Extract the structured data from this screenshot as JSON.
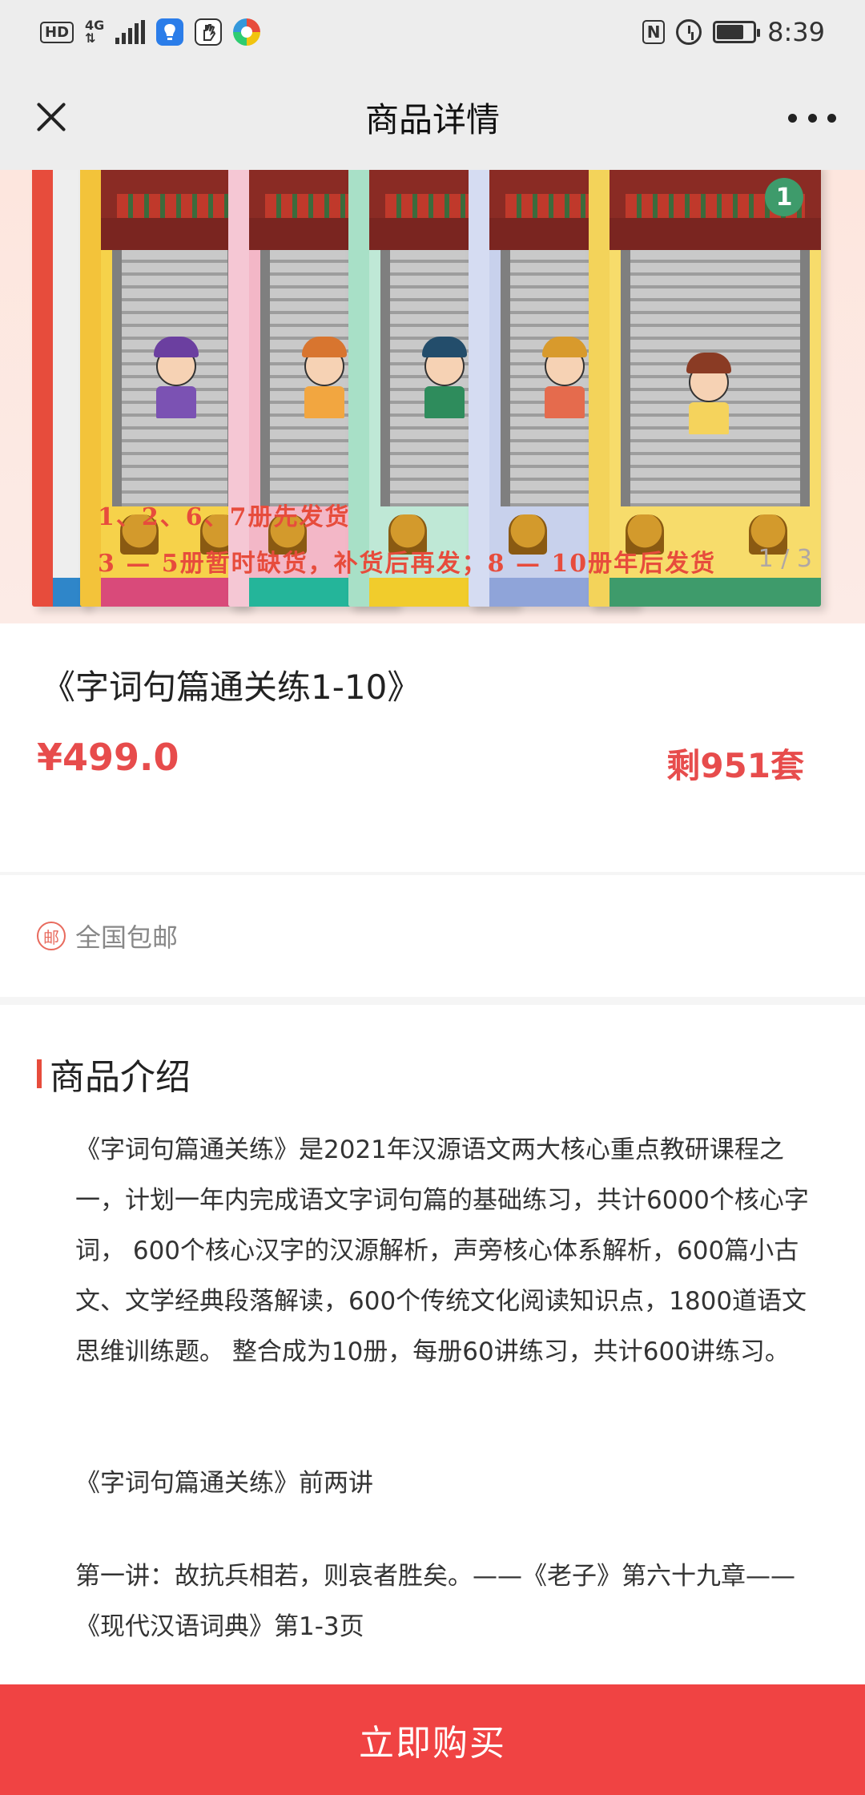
{
  "status_bar": {
    "hd": "HD",
    "network_top": "4G",
    "network_bottom": "⇅",
    "nfc": "N",
    "time": "8:39",
    "battery_level": 0.75,
    "icons": [
      "hd-icon",
      "signal-icon",
      "lightbulb-app-icon",
      "hand-app-icon",
      "color-app-icon",
      "nfc-icon",
      "alarm-icon",
      "battery-icon"
    ]
  },
  "nav": {
    "title": "商品详情",
    "left_icon": "close-icon",
    "right_icon": "more-icon"
  },
  "banner": {
    "line1": "1、2、6、7册先发货",
    "line2": "3 — 5册暂时缺货，补货后再发；8 — 10册年后发货",
    "indicator": "1 / 3",
    "cover_number": "1"
  },
  "product": {
    "name": "《字词句篇通关练1-10》",
    "price": "¥499.0",
    "stock": "剩951套"
  },
  "shipping": {
    "icon_text": "邮",
    "label": "全国包邮"
  },
  "intro": {
    "title": "商品介绍",
    "paragraph1": "《字词句篇通关练》是2021年汉源语文两大核心重点教研课程之一，计划一年内完成语文字词句篇的基础练习，共计6000个核心字词， 600个核心汉字的汉源解析，声旁核心体系解析，600篇小古文、文学经典段落解读，600个传统文化阅读知识点，1800道语文思维训练题。 整合成为10册，每册60讲练习，共计600讲练习。",
    "paragraph2": "《字词句篇通关练》前两讲",
    "paragraph3": "第一讲：故抗兵相若，则哀者胜矣。——《老子》第六十九章——《现代汉语词典》第1-3页"
  },
  "buy_button": {
    "label": "立即购买"
  },
  "colors": {
    "accent": "#e74c4c",
    "buy_button": "#f04343",
    "nav_background": "#ededed",
    "banner_background": "#fde6de"
  }
}
